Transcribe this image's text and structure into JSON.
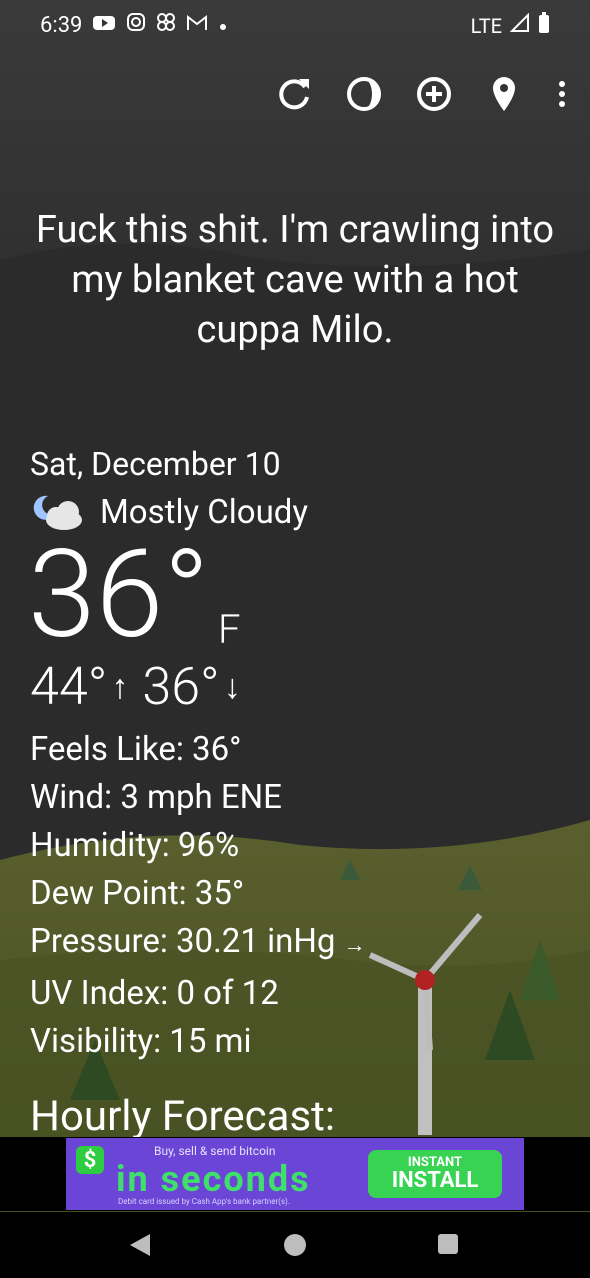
{
  "status_bar": {
    "time": "6:39",
    "network": "LTE",
    "notification_icons": [
      "youtube-icon",
      "instagram-icon",
      "pinwheel-icon",
      "gmail-icon",
      "dot-icon"
    ],
    "system_icons": [
      "signal-icon",
      "battery-icon"
    ]
  },
  "toolbar": {
    "icons": [
      "refresh-icon",
      "theme-icon",
      "add-location-icon",
      "location-pin-icon",
      "more-vert-icon"
    ]
  },
  "quote": "Fuck this shit. I'm crawling into my blanket cave with a hot cuppa Milo.",
  "weather": {
    "date": "Sat, December 10",
    "condition": "Mostly Cloudy",
    "condition_icon": "cloudy-night-icon",
    "temperature": "36°",
    "unit": "F",
    "high": "44°",
    "low": "36°",
    "high_arrow": "↑",
    "low_arrow": "↓",
    "feels_like": "Feels Like:  36°",
    "wind": "Wind:  3 mph ENE",
    "humidity": "Humidity:  96%",
    "dew_point": "Dew Point:  35°",
    "pressure": "Pressure:  30.21 inHg",
    "pressure_arrow": "→",
    "uv_index": "UV Index:  0 of 12",
    "visibility": "Visibility:  15 mi"
  },
  "hourly_heading": "Hourly Forecast:",
  "ad": {
    "top_text": "Buy, sell & send bitcoin",
    "main_text": "in seconds",
    "fine_print": "Debit card issued by Cash App's bank partner(s).",
    "button_line1": "INSTANT",
    "button_line2": "INSTALL"
  },
  "nav": {
    "icons": [
      "back-icon",
      "home-icon",
      "recents-icon"
    ]
  }
}
